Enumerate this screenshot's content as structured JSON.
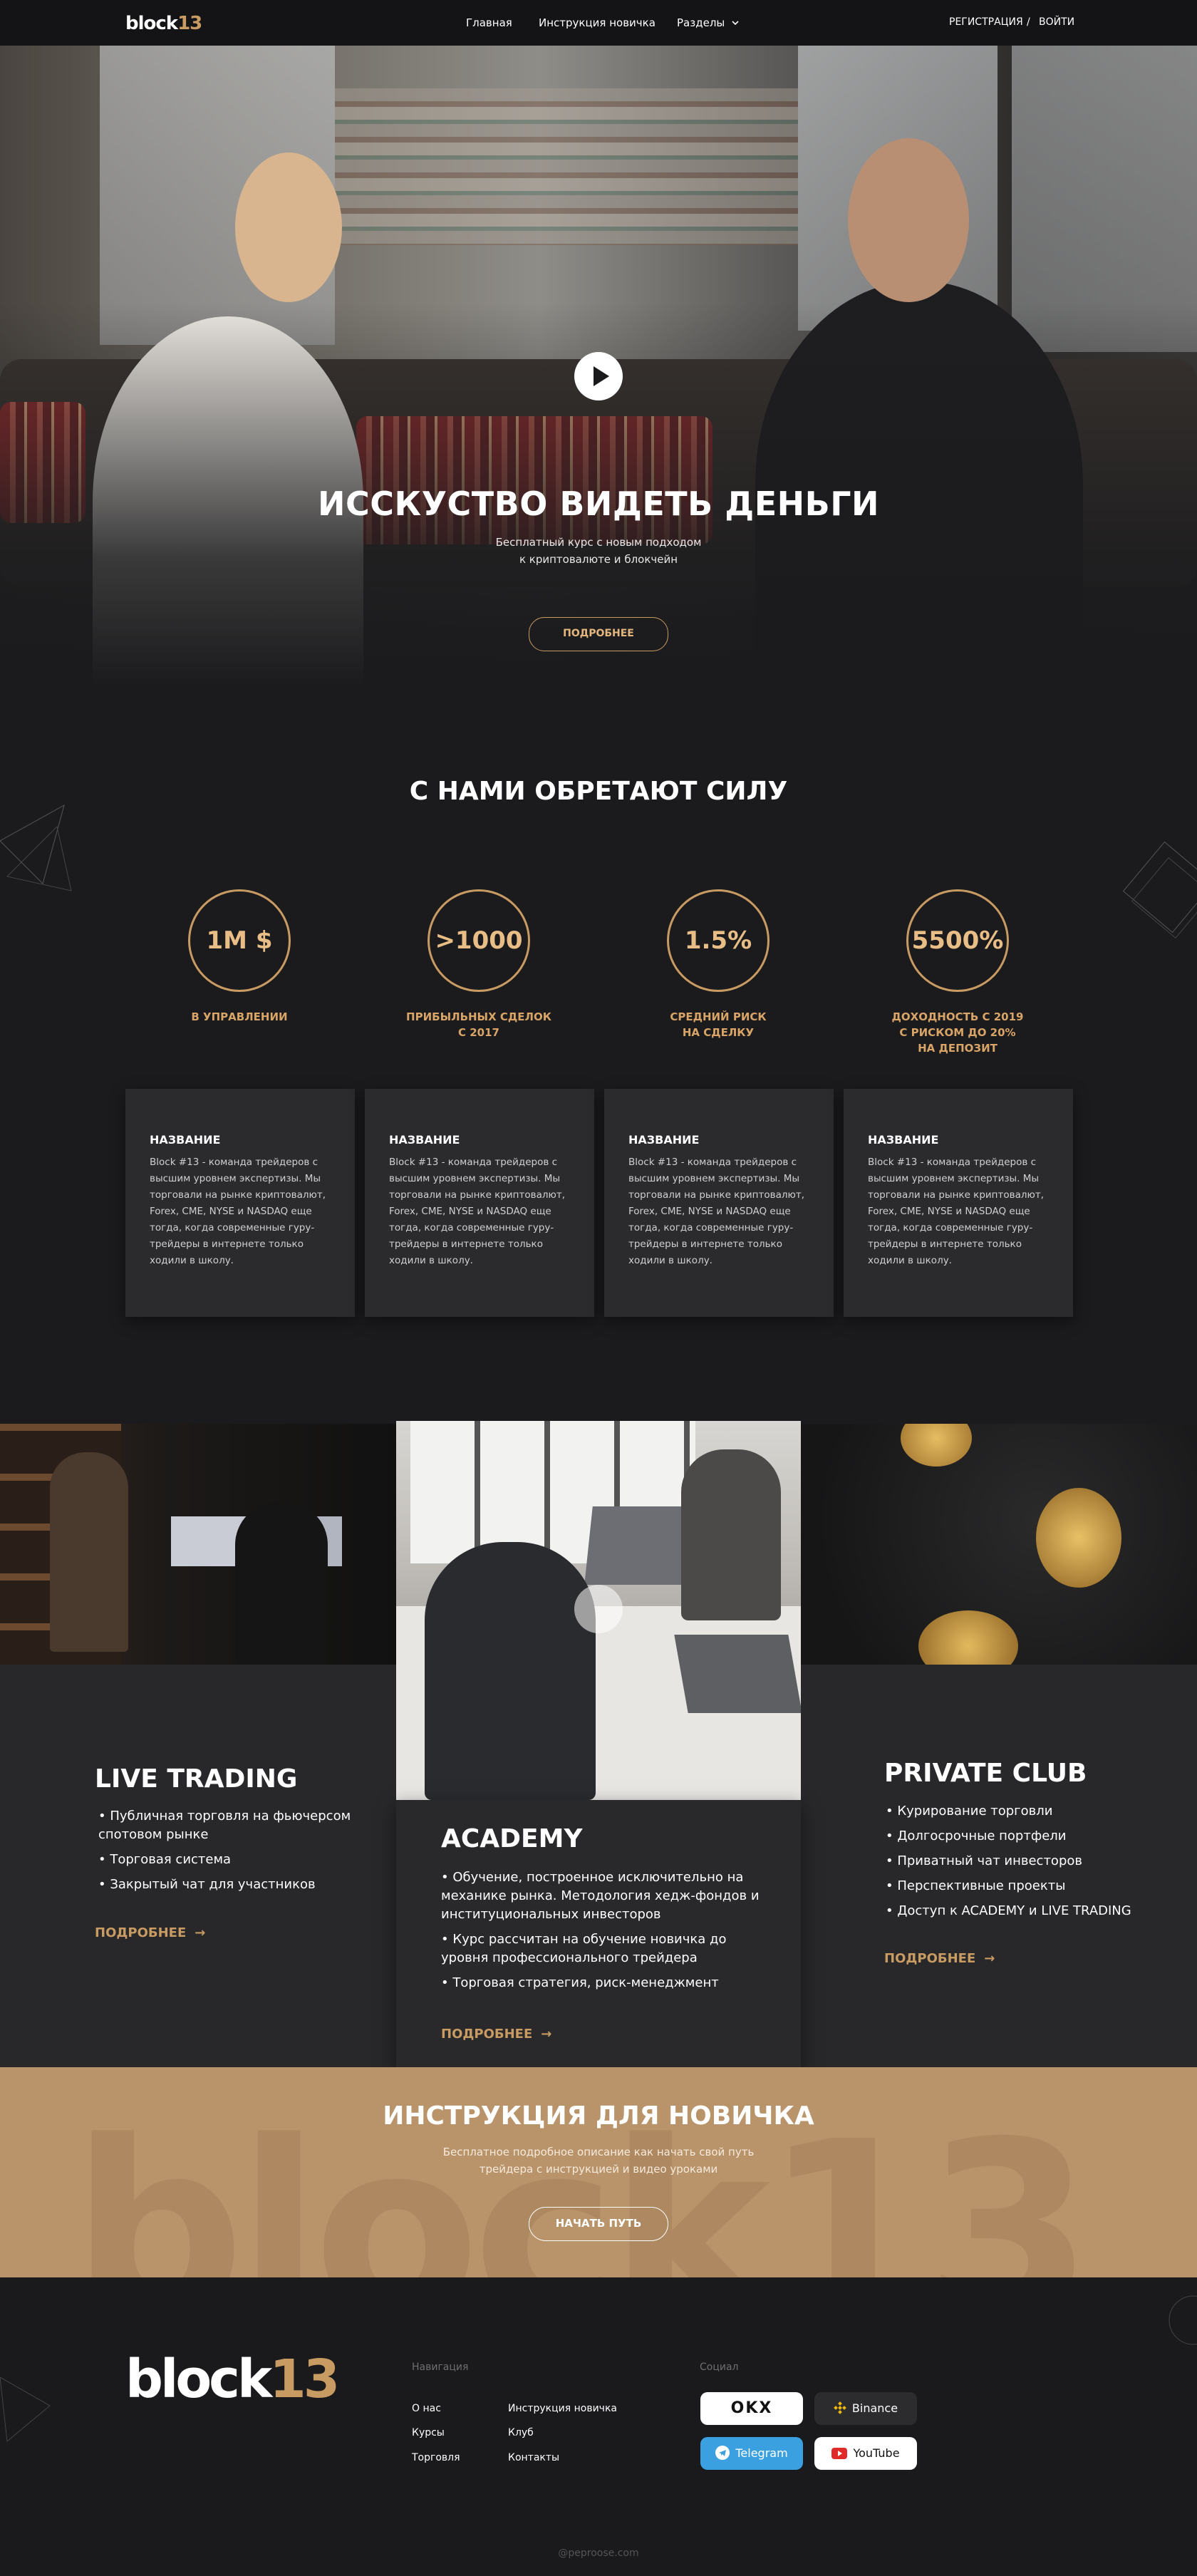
{
  "header": {
    "logo": {
      "main": "block",
      "accent": "13"
    },
    "nav": [
      "Главная",
      "Инструкция новичка",
      "Разделы"
    ],
    "register": "РЕГИСТРАЦИЯ",
    "separator": "/",
    "login": "ВОЙТИ"
  },
  "hero": {
    "title": "ИССКУСТВО ВИДЕТЬ ДЕНЬГИ",
    "subtitle_lines": [
      "Бесплатный курс с новым подходом",
      "к криптовалюте и блокчейн"
    ],
    "button": "ПОДРОБНЕЕ"
  },
  "stats": {
    "title": "С НАМИ ОБРЕТАЮТ СИЛУ",
    "items": [
      {
        "value": "1M $",
        "label_lines": [
          "В УПРАВЛЕНИИ"
        ]
      },
      {
        "value": ">1000",
        "label_lines": [
          "ПРИБЫЛЬНЫХ СДЕЛОК",
          "С 2017"
        ]
      },
      {
        "value": "1.5%",
        "label_lines": [
          "СРЕДНИЙ РИСК",
          "НА СДЕЛКУ"
        ]
      },
      {
        "value": "5500%",
        "label_lines": [
          "ДОХОДНОСТЬ С 2019",
          "С РИСКОМ ДО 20%",
          "НА ДЕПОЗИТ"
        ]
      }
    ],
    "cards": [
      {
        "title": "НАЗВАНИЕ",
        "text": "Block #13 - команда трейдеров с высшим уровнем экспертизы. Мы торговали на рынке криптовалют, Forex, CME, NYSE и NASDAQ еще тогда, когда современные гуру-трейдеры в интернете только ходили в школу."
      },
      {
        "title": "НАЗВАНИЕ",
        "text": "Block #13 - команда трейдеров с высшим уровнем экспертизы. Мы торговали на рынке криптовалют, Forex, CME, NYSE и NASDAQ еще тогда, когда современные гуру-трейдеры в интернете только ходили в школу."
      },
      {
        "title": "НАЗВАНИЕ",
        "text": "Block #13 - команда трейдеров с высшим уровнем экспертизы. Мы торговали на рынке криптовалют, Forex, CME, NYSE и NASDAQ еще тогда, когда современные гуру-трейдеры в интернете только ходили в школу."
      },
      {
        "title": "НАЗВАНИЕ",
        "text": "Block #13 - команда трейдеров с высшим уровнем экспертизы. Мы торговали на рынке криптовалют, Forex, CME, NYSE и NASDAQ еще тогда, когда современные гуру-трейдеры в интернете только ходили в школу."
      }
    ]
  },
  "services": {
    "live": {
      "title": "LIVE TRADING",
      "items": [
        "• Публичная торговля на фьючерсом спотовом рынке",
        "• Торговая система",
        "• Закрытый чат для участников"
      ],
      "link": "ПОДРОБНЕЕ"
    },
    "academy": {
      "title": "ACADEMY",
      "items": [
        "• Обучение, построенное исключительно на механике рынка. Методология хедж-фондов и институциональных инвесторов",
        "• Курс рассчитан на обучение новичка до уровня профессионального трейдера",
        "• Торговая стратегия, риск-менеджмент"
      ],
      "link": "ПОДРОБНЕЕ"
    },
    "club": {
      "title": "PRIVATE CLUB",
      "items": [
        "• Курирование торговли",
        "• Долгосрочные портфели",
        "• Приватный чат инвесторов",
        "• Перспективные проекты",
        "• Доступ к ACADEMY и LIVE TRADING"
      ],
      "link": "ПОДРОБНЕЕ"
    }
  },
  "beginner": {
    "title": "ИНСТРУКЦИЯ ДЛЯ НОВИЧКА",
    "subtitle_lines": [
      "Бесплатное подробное описание как начать свой путь",
      "трейдера с инструкцией и видео уроками"
    ],
    "button": "НАЧАТЬ ПУТЬ",
    "watermark": "block13"
  },
  "footer": {
    "logo": {
      "main": "block",
      "accent": "13"
    },
    "nav_heading": "Навигация",
    "nav_col1": [
      "О нас",
      "Курсы",
      "Торговля"
    ],
    "nav_col2": [
      "Инструкция новичка",
      "Клуб",
      "Контакты"
    ],
    "social_heading": "Социал",
    "social": {
      "okx": "OKX",
      "binance": "Binance",
      "telegram": "Telegram",
      "youtube": "YouTube"
    },
    "copyright": "@peproose.com"
  },
  "colors": {
    "accent": "#c89b63",
    "background": "#1b1b1d",
    "card": "#2b2a2d",
    "gold_band": "#b9936a",
    "telegram": "#3aa0e0",
    "youtube_red": "#e02a2a"
  }
}
